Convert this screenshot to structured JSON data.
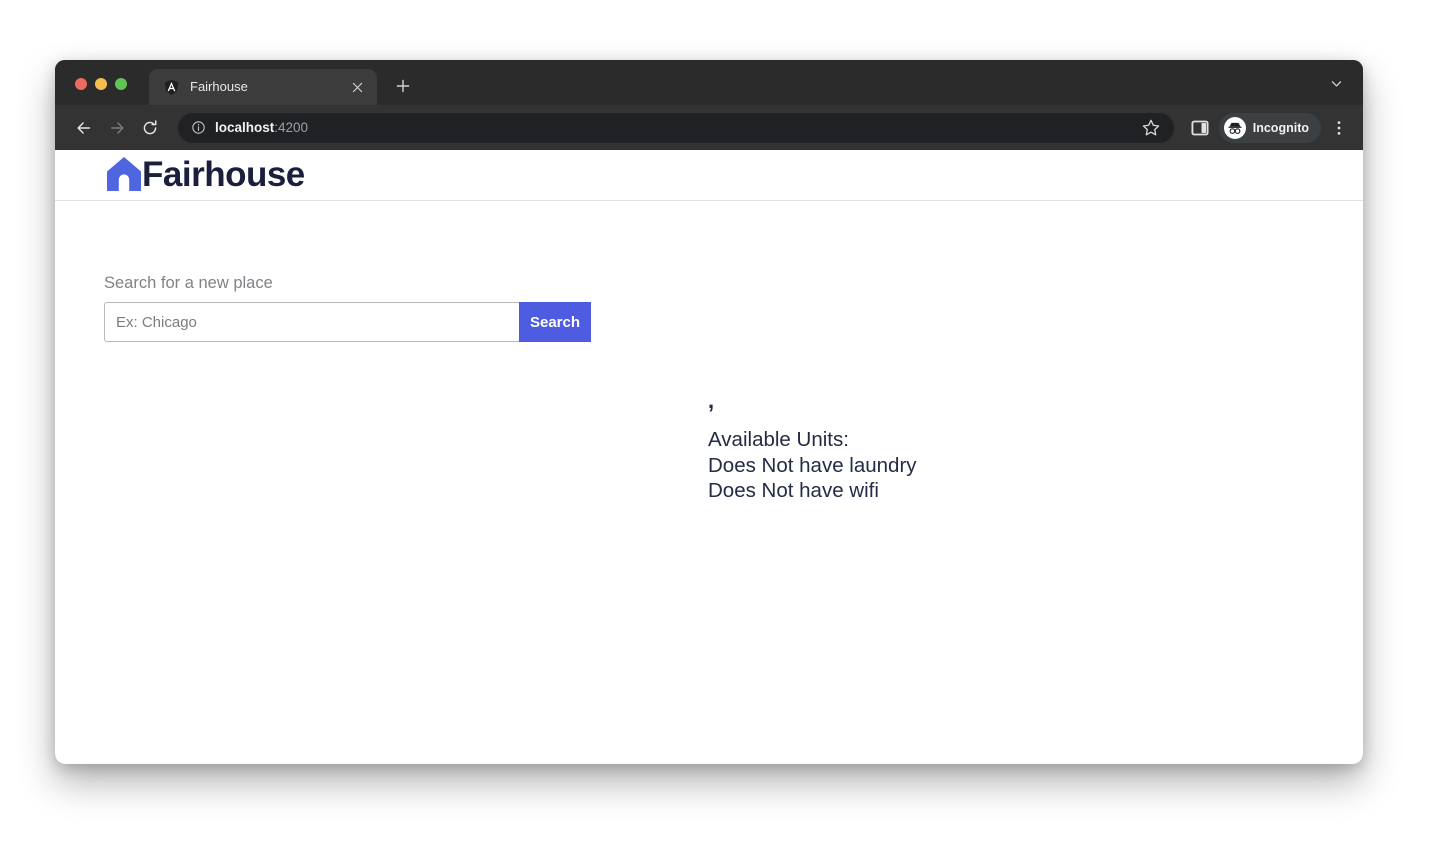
{
  "browser": {
    "tab": {
      "title": "Fairhouse",
      "favicon": "angular-icon",
      "close_label": "×"
    },
    "new_tab_label": "+",
    "tab_search_icon": "chevron-down-icon",
    "toolbar": {
      "back_icon": "back-arrow-icon",
      "forward_icon": "forward-arrow-icon",
      "reload_icon": "reload-icon",
      "site_info_icon": "info-circle-icon",
      "url_host": "localhost",
      "url_port": ":4200",
      "bookmark_icon": "star-icon",
      "side_panel_icon": "side-panel-icon",
      "profile_label": "Incognito",
      "profile_icon": "incognito-spy-icon",
      "menu_icon": "kebab-menu-icon"
    }
  },
  "app": {
    "header": {
      "logo_icon": "house-icon",
      "brand_name": "Fairhouse",
      "brand_color": "#4f66e0",
      "text_color": "#1b1f3b"
    },
    "search": {
      "label": "Search for a new place",
      "placeholder": "Ex: Chicago",
      "value": "",
      "button_label": "Search",
      "button_color": "#4d5ce0"
    },
    "results": {
      "separator": ",",
      "lines": [
        "Available Units:",
        "Does Not have laundry",
        "Does Not have wifi"
      ]
    }
  }
}
